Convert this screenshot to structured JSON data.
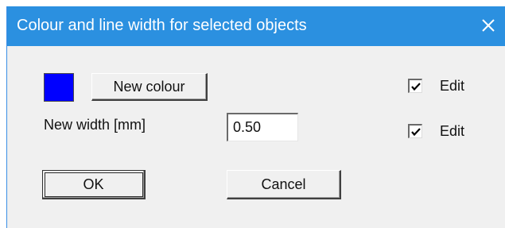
{
  "dialog": {
    "title": "Colour and line width for selected objects",
    "close_icon": "close-icon"
  },
  "colour": {
    "swatch_color": "#0000ff",
    "new_colour_label": "New colour",
    "edit_checked": true,
    "edit_label": "Edit"
  },
  "width": {
    "label": "New width [mm]",
    "value": "0.50",
    "edit_checked": true,
    "edit_label": "Edit"
  },
  "actions": {
    "ok_label": "OK",
    "cancel_label": "Cancel"
  }
}
